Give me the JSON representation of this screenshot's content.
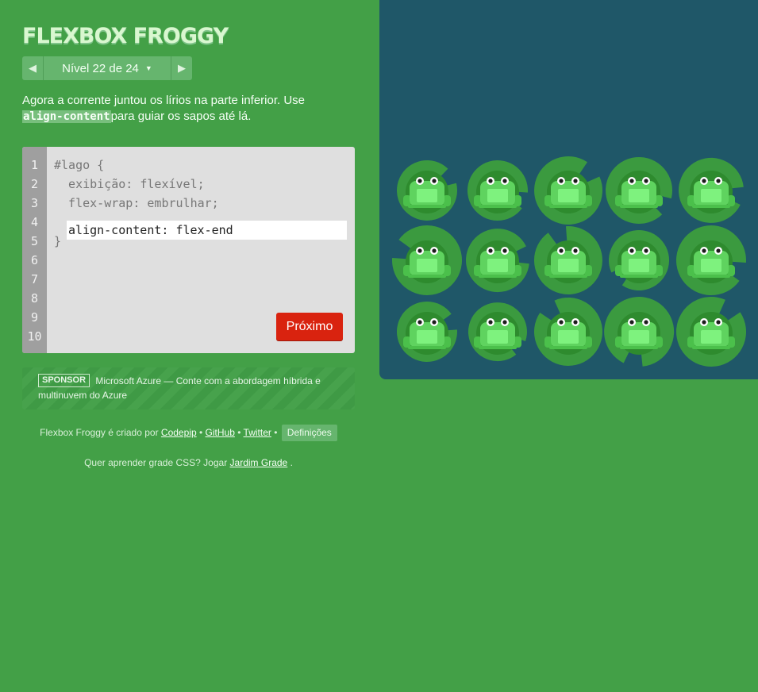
{
  "header": {
    "title": "FLEXBOX FROGGY",
    "level_indicator": "Nível 22 de 24",
    "prev_icon": "triangle-left-icon",
    "next_icon": "triangle-right-icon"
  },
  "instructions": {
    "text_before": "Agora a corrente juntou os lírios na parte inferior. Use",
    "code": "align-content",
    "text_after": "para guiar os sapos até lá."
  },
  "editor": {
    "line_numbers": [
      "1",
      "2",
      "3",
      "4",
      "5",
      "6",
      "7",
      "8",
      "9",
      "10"
    ],
    "lines": [
      "#lago {",
      "  exibição: flexível;",
      "  flex-wrap: embrulhar;",
      "",
      "}"
    ],
    "input_value": "align-content: flex-end",
    "next_button": "Próximo"
  },
  "sponsor": {
    "badge": "SPONSOR",
    "text": "Microsoft Azure — Conte com a abordagem híbrida e multinuvem do Azure"
  },
  "credits": {
    "prefix": "Flexbox Froggy é criado por",
    "codepip": "Codepip",
    "sep1": "•",
    "github": "GitHub",
    "sep2": "•",
    "twitter": "Twitter",
    "sep3": "•",
    "settings": "Definições"
  },
  "grid_promo": {
    "prefix": "Quer aprender grade CSS? Jogar",
    "link": "Jardim Grade",
    "suffix": "."
  },
  "board": {
    "colors": {
      "water": "#1f5768",
      "lilypad": "#3b9a3f",
      "frog_body": "#2e8b2e",
      "frog_belly": "#7ef27e"
    },
    "frog_count": 15,
    "lilypad_count": 15
  }
}
